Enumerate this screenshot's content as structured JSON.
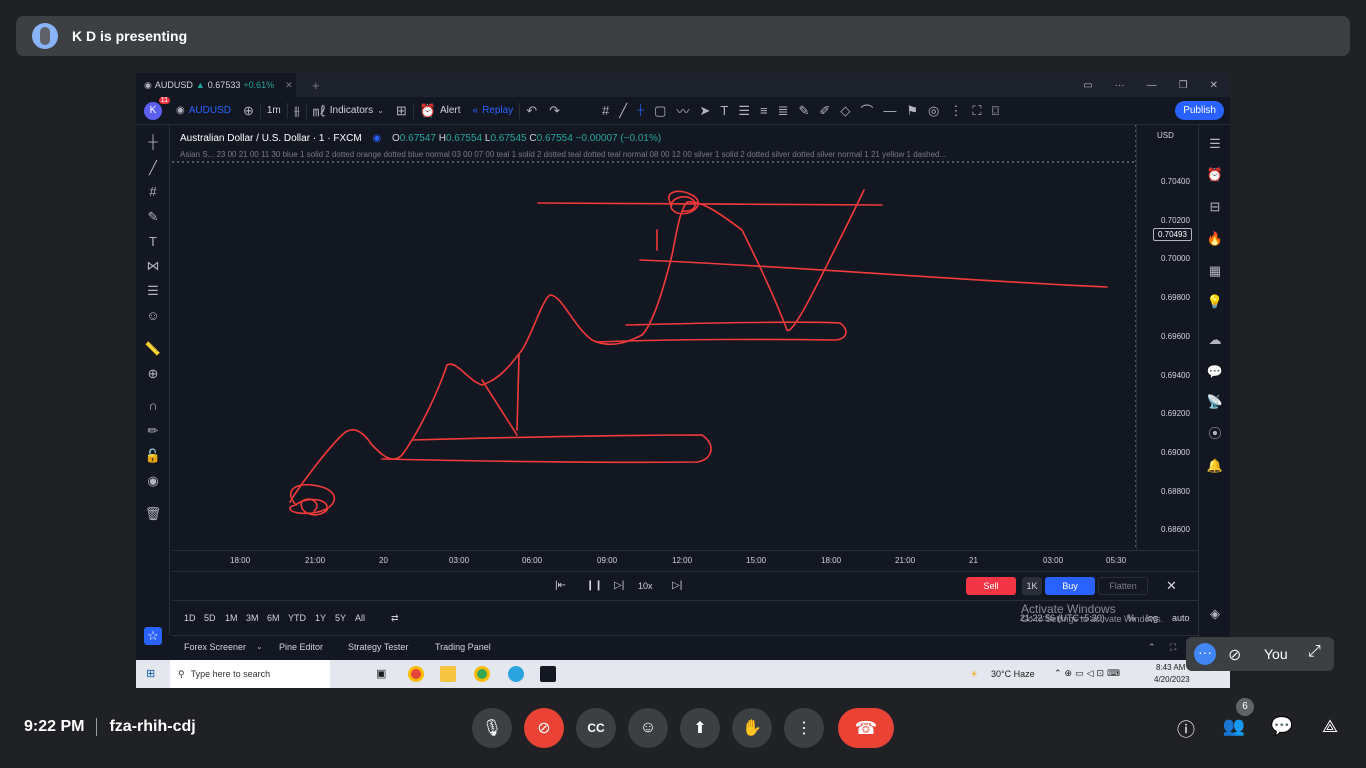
{
  "banner": {
    "presenting": "K D is presenting"
  },
  "tv": {
    "tab": {
      "symbol": "AUDUSD",
      "price": "0.67533",
      "change": "+0.61%"
    },
    "toolbar": {
      "avatar": "K",
      "avatar_badge": "11",
      "symbol": "AUDUSD",
      "interval": "1m",
      "indicators": "Indicators",
      "alert": "Alert",
      "replay": "Replay",
      "publish": "Publish"
    },
    "legend": {
      "title": "Australian Dollar / U.S. Dollar · 1 · FXCM",
      "o_label": "O",
      "o": "0.67547",
      "h_label": "H",
      "h": "0.67554",
      "l_label": "L",
      "l": "0.67545",
      "c_label": "C",
      "c": "0.67554",
      "chg": "−0.00007 (−0.01%)",
      "indicator": "Asian S...  23 00 21 00 11 30 blue 1 solid 2 dotted orange dotted blue normal 03 00 07 00 teal 1 solid 2 dotted teal dotted teal normal 08 00 12 00 silver 1 solid 2 dotted silver dotted silver normal 1 21 yellow 1 dashed..."
    },
    "price_axis": {
      "currency": "USD",
      "current": "0.70493",
      "labels": [
        "0.70400",
        "0.70200",
        "0.70000",
        "0.69800",
        "0.69600",
        "0.69400",
        "0.69200",
        "0.69000",
        "0.68800",
        "0.68600"
      ]
    },
    "time_axis": [
      "18:00",
      "21:00",
      "20",
      "03:00",
      "06:00",
      "09:00",
      "12:00",
      "15:00",
      "18:00",
      "21:00",
      "21",
      "03:00",
      "05:30"
    ],
    "replay": {
      "speed": "10x",
      "sell": "Sell",
      "qty": "1K",
      "buy": "Buy",
      "flatten": "Flatten"
    },
    "ranges": [
      "1D",
      "5D",
      "1M",
      "3M",
      "6M",
      "YTD",
      "1Y",
      "5Y",
      "All"
    ],
    "clock": "21:22:56 (UTC+5:30)",
    "scale": {
      "pct": "%",
      "log": "log",
      "auto": "auto"
    },
    "activate": {
      "line1": "Activate Windows",
      "line2": "Go to Settings to activate Windows."
    },
    "bottom_tabs": [
      "Forex Screener",
      "Pine Editor",
      "Strategy Tester",
      "Trading Panel"
    ],
    "taskbar": {
      "search": "Type here to search",
      "weather": "30°C  Haze",
      "time": "8:43 AM",
      "date": "4/20/2023"
    }
  },
  "self_tile": {
    "label": "You"
  },
  "meeting": {
    "time": "9:22 PM",
    "code": "fza-rhih-cdj",
    "participants": "6"
  },
  "colors": {
    "bg": "#202124",
    "chart_bg": "#131722",
    "drawing": "#f23a3a",
    "accent": "#2962ff",
    "end_call": "#ea4335"
  }
}
